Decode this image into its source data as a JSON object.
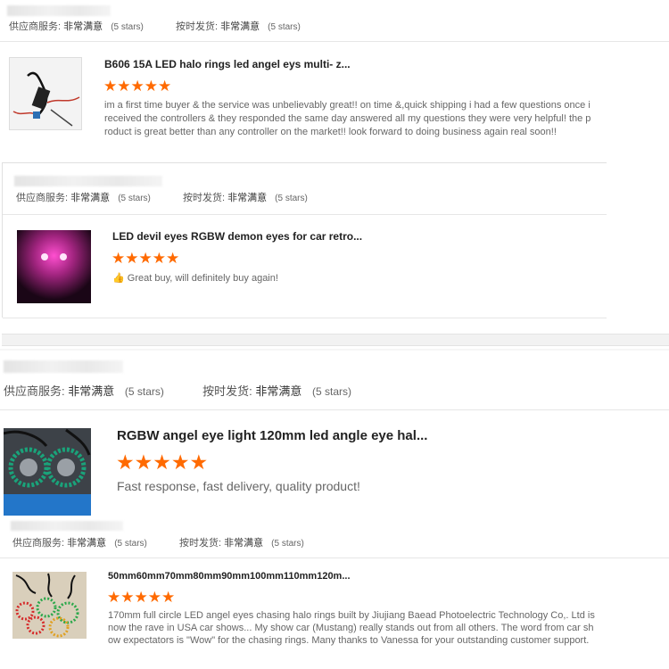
{
  "reviews": [
    {
      "seller": {
        "supplier_label": "供应商服务:",
        "supplier_value": "非常满意",
        "supplier_stars": "(5 stars)",
        "shipping_label": "按时发货:",
        "shipping_value": "非常满意",
        "shipping_stars": "(5 stars)"
      },
      "title": "B606 15A LED halo rings led angel eys multi- z...",
      "stars": "★★★★★",
      "review": "im a first time buyer & the service was unbelievably great!! on time &,quick shipping i had a few questions once i received the controllers & they responded the same day answered all my questions they were very helpful! the product is great better than any controller on the market!! look forward to doing business again real soon!!"
    },
    {
      "seller": {
        "supplier_label": "供应商服务:",
        "supplier_value": "非常满意",
        "supplier_stars": "(5 stars)",
        "shipping_label": "按时发货:",
        "shipping_value": "非常满意",
        "shipping_stars": "(5 stars)"
      },
      "title": "LED devil eyes RGBW demon eyes for car retro...",
      "stars": "★★★★★",
      "thumb_icon": "👍",
      "review": "Great buy, will definitely buy again!"
    },
    {
      "seller": {
        "supplier_label": "供应商服务:",
        "supplier_value": "非常满意",
        "supplier_stars": "(5 stars)",
        "shipping_label": "按时发货:",
        "shipping_value": "非常满意",
        "shipping_stars": "(5 stars)"
      },
      "title": "RGBW angel eye light 120mm led angle eye hal...",
      "stars": "★★★★★",
      "review": "Fast response, fast delivery, quality product!"
    },
    {
      "seller": {
        "supplier_label": "供应商服务:",
        "supplier_value": "非常满意",
        "supplier_stars": "(5 stars)",
        "shipping_label": "按时发货:",
        "shipping_value": "非常满意",
        "shipping_stars": "(5 stars)"
      },
      "title": "50mm60mm70mm80mm90mm100mm110mm120m...",
      "stars": "★★★★★",
      "review": "170mm full circle LED angel eyes chasing halo rings built by Jiujiang Baead Photoelectric Technology Co,. Ltd is now the rave in USA car shows... My show car (Mustang) really stands out from all others.  The word from car show expectators is \"Wow\"  for the chasing rings.  Many thanks to Vanessa for your outstanding customer support."
    }
  ],
  "colors": {
    "star": "#ff6a00",
    "text": "#333333",
    "muted": "#666666",
    "divider": "#e6e6e6"
  }
}
